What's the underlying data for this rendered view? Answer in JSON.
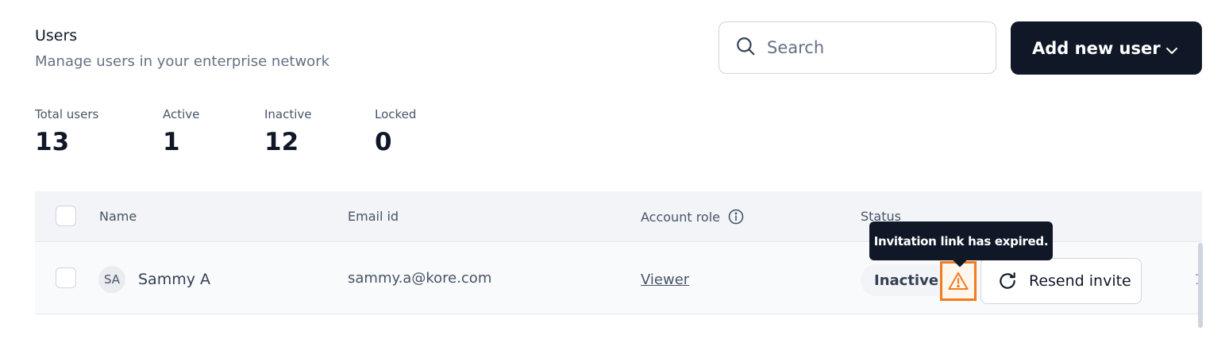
{
  "header": {
    "title": "Users",
    "subtitle": "Manage users in your enterprise network"
  },
  "search": {
    "placeholder": "Search"
  },
  "add_user": {
    "label": "Add new user"
  },
  "stats": [
    {
      "label": "Total users",
      "value": "13"
    },
    {
      "label": "Active",
      "value": "1"
    },
    {
      "label": "Inactive",
      "value": "12"
    },
    {
      "label": "Locked",
      "value": "0"
    }
  ],
  "table": {
    "columns": {
      "name": "Name",
      "email": "Email id",
      "role": "Account role",
      "status": "Status"
    },
    "rows": [
      {
        "initials": "SA",
        "name": "Sammy A",
        "email": "sammy.a@kore.com",
        "role": "Viewer",
        "status": "Inactive",
        "action": "Resend invite",
        "truncated": "1"
      }
    ]
  },
  "tooltip": {
    "text": "Invitation link has expired."
  },
  "colors": {
    "primary": "#101828",
    "warning": "#f27b20",
    "muted": "#667085"
  },
  "icons": {
    "search": "search-icon",
    "chevron": "chevron-down-icon",
    "info": "info-icon",
    "warning": "warning-triangle-icon",
    "refresh": "refresh-icon"
  }
}
